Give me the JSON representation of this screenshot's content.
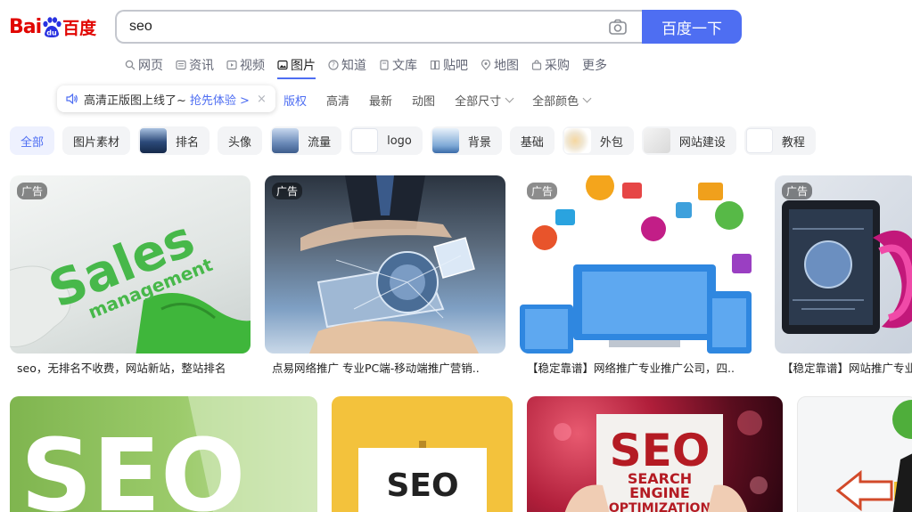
{
  "header": {
    "logo_latin": "Bai",
    "logo_du": "du",
    "logo_cn": "百度",
    "search_value": "seo",
    "search_button": "百度一下"
  },
  "tabs": [
    {
      "label": "网页",
      "icon": "search-icon"
    },
    {
      "label": "资讯",
      "icon": "news-icon"
    },
    {
      "label": "视频",
      "icon": "video-icon"
    },
    {
      "label": "图片",
      "icon": "image-icon",
      "active": true
    },
    {
      "label": "知道",
      "icon": "question-icon"
    },
    {
      "label": "文库",
      "icon": "document-icon"
    },
    {
      "label": "贴吧",
      "icon": "tieba-icon"
    },
    {
      "label": "地图",
      "icon": "map-pin-icon"
    },
    {
      "label": "采购",
      "icon": "shopping-icon"
    },
    {
      "label": "更多",
      "icon": ""
    }
  ],
  "promo": {
    "message": "高清正版图上线了~",
    "link": "抢先体验 >",
    "close": "×"
  },
  "filters": [
    {
      "label": "版权"
    },
    {
      "label": "高清"
    },
    {
      "label": "最新"
    },
    {
      "label": "动图"
    },
    {
      "label": "全部尺寸",
      "dropdown": true
    },
    {
      "label": "全部颜色",
      "dropdown": true
    }
  ],
  "chips": [
    {
      "label": "全部",
      "active": true
    },
    {
      "label": "图片素材"
    },
    {
      "label": "排名",
      "thumb": "#2c4a7a"
    },
    {
      "label": "头像"
    },
    {
      "label": "流量",
      "thumb": "#6a8ab8"
    },
    {
      "label": "logo",
      "thumb": "#dfe6f3"
    },
    {
      "label": "背景",
      "thumb": "#7ea9d6"
    },
    {
      "label": "基础"
    },
    {
      "label": "外包",
      "thumb": "#f0e6d2"
    },
    {
      "label": "网站建设",
      "thumb": "#e6e6e6"
    },
    {
      "label": "教程",
      "thumb": "#ffffff"
    }
  ],
  "ad_label": "广告",
  "captions": [
    "seo，无排名不收费，网站新站，整站排名",
    "点易网络推广 专业PC端-移动端推广营销..",
    "【稳定靠谱】网络推广专业推广公司，四..",
    "【稳定靠谱】网站推广专业"
  ],
  "image_text": {
    "sales": "Sales",
    "management": "management",
    "seo": "SEO",
    "search": "SEARCH",
    "engine": "ENGINE",
    "optimization": "OPTIMIZATION"
  },
  "colors": {
    "brand": "#4e6ef2",
    "logo_red": "#e10602",
    "logo_blue": "#2932e1"
  }
}
